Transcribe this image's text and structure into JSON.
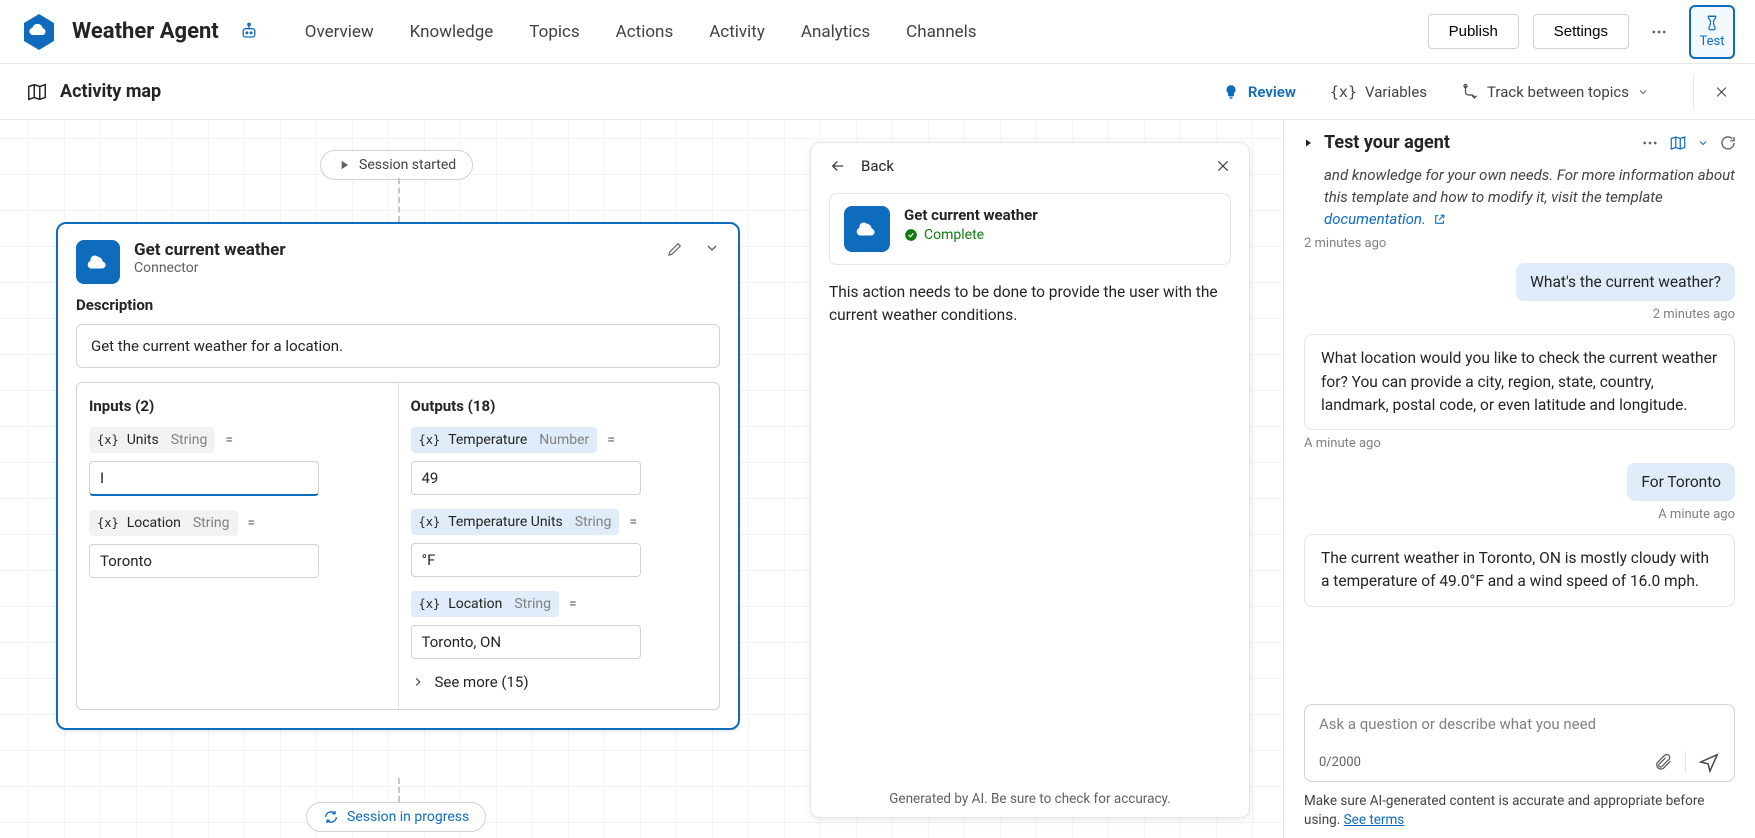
{
  "header": {
    "title": "Weather Agent",
    "nav": [
      "Overview",
      "Knowledge",
      "Topics",
      "Actions",
      "Activity",
      "Analytics",
      "Channels"
    ],
    "publish": "Publish",
    "settings": "Settings",
    "test": "Test"
  },
  "toolbar": {
    "title": "Activity map",
    "review": "Review",
    "variables": "Variables",
    "track": "Track between topics"
  },
  "session": {
    "started": "Session started",
    "progress": "Session in progress"
  },
  "node": {
    "title": "Get current weather",
    "subtitle": "Connector",
    "descLabel": "Description",
    "description": "Get the current weather for a location.",
    "inputsLabel": "Inputs (2)",
    "outputsLabel": "Outputs (18)",
    "inputs": [
      {
        "name": "Units",
        "type": "String",
        "value": "I"
      },
      {
        "name": "Location",
        "type": "String",
        "value": "Toronto"
      }
    ],
    "outputs": [
      {
        "name": "Temperature",
        "type": "Number",
        "value": "49"
      },
      {
        "name": "Temperature Units",
        "type": "String",
        "value": "°F"
      },
      {
        "name": "Location",
        "type": "String",
        "value": "Toronto, ON"
      }
    ],
    "seeMore": "See more (15)"
  },
  "detail": {
    "back": "Back",
    "title": "Get current weather",
    "status": "Complete",
    "desc": "This action needs to be done to provide the user with the current weather conditions.",
    "footer": "Generated by AI. Be sure to check for accuracy."
  },
  "testPanel": {
    "title": "Test your agent",
    "intro": "and knowledge for your own needs. For more information about this template and how to modify it, visit the template ",
    "introLink": "documentation.",
    "ts1": "2 minutes ago",
    "userMsg1": "What's the current weather?",
    "ts2": "2 minutes ago",
    "botMsg1": "What location would you like to check the current weather for? You can provide a city, region, state, country, landmark, postal code, or even latitude and longitude.",
    "ts3": "A minute ago",
    "userMsg2": "For Toronto",
    "ts4": "A minute ago",
    "botMsg2": "The current weather in Toronto, ON is mostly cloudy with a temperature of 49.0°F and a wind speed of 16.0 mph.",
    "placeholder": "Ask a question or describe what you need",
    "charCount": "0/2000",
    "disclaimer": "Make sure AI-generated content is accurate and appropriate before using. ",
    "disclaimerLink": "See terms"
  }
}
